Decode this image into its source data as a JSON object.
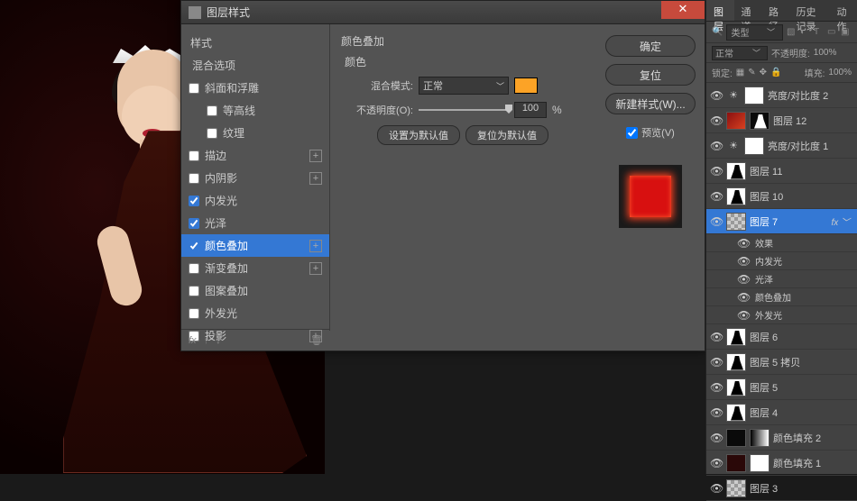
{
  "dialog": {
    "title": "图层样式",
    "styles_header": "样式",
    "blend_options": "混合选项",
    "items": [
      {
        "label": "斜面和浮雕",
        "checked": false,
        "plus": false
      },
      {
        "label": "等高线",
        "checked": false,
        "sub": true
      },
      {
        "label": "纹理",
        "checked": false,
        "sub": true
      },
      {
        "label": "描边",
        "checked": false,
        "plus": true
      },
      {
        "label": "内阴影",
        "checked": false,
        "plus": true
      },
      {
        "label": "内发光",
        "checked": true
      },
      {
        "label": "光泽",
        "checked": true
      },
      {
        "label": "颜色叠加",
        "checked": true,
        "plus": true,
        "selected": true
      },
      {
        "label": "渐变叠加",
        "checked": false,
        "plus": true
      },
      {
        "label": "图案叠加",
        "checked": false
      },
      {
        "label": "外发光",
        "checked": false
      },
      {
        "label": "投影",
        "checked": false,
        "plus": true
      }
    ],
    "footer_fx": "fx",
    "settings": {
      "title": "颜色叠加",
      "subtitle": "颜色",
      "blend_mode_label": "混合模式:",
      "blend_mode_value": "正常",
      "opacity_label": "不透明度(O):",
      "opacity_value": "100",
      "opacity_unit": "%",
      "set_default": "设置为默认值",
      "reset_default": "复位为默认值"
    },
    "buttons": {
      "ok": "确定",
      "cancel": "复位",
      "new_style": "新建样式(W)...",
      "preview": "预览(V)"
    }
  },
  "panels": {
    "tabs": [
      "图层",
      "通道",
      "路径",
      "历史记录",
      "动作"
    ],
    "type_filter": "类型",
    "blend_mode": "正常",
    "opacity_label": "不透明度:",
    "opacity_value": "100%",
    "lock": "锁定:",
    "fill_label": "填充:",
    "fill_value": "100%",
    "layers": [
      {
        "name": "亮度/对比度 2",
        "type": "adj"
      },
      {
        "name": "图层 12",
        "type": "img-red"
      },
      {
        "name": "亮度/对比度 1",
        "type": "adj"
      },
      {
        "name": "图层 11",
        "type": "dress"
      },
      {
        "name": "图层 10",
        "type": "dress"
      },
      {
        "name": "图层 7",
        "type": "checker",
        "selected": true,
        "fx": true
      },
      {
        "name": "图层 6",
        "type": "dress"
      },
      {
        "name": "图层 5 拷贝",
        "type": "dress"
      },
      {
        "name": "图层 5",
        "type": "dress"
      },
      {
        "name": "图层 4",
        "type": "dress"
      },
      {
        "name": "颜色填充 2",
        "type": "grad"
      },
      {
        "name": "颜色填充 1",
        "type": "darkred"
      },
      {
        "name": "图层 3",
        "type": "checker"
      }
    ],
    "effects_header": "效果",
    "effects": [
      "内发光",
      "光泽",
      "颜色叠加",
      "外发光"
    ]
  }
}
